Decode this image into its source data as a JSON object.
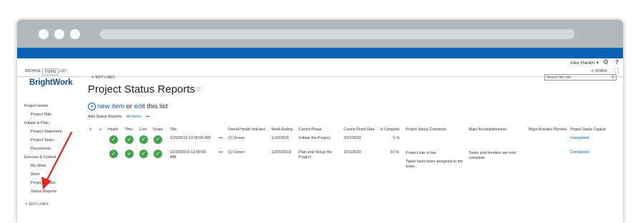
{
  "user": {
    "name": "Alex Hankin"
  },
  "ribbon": {
    "tabs": [
      "BROWSE",
      "ITEMS",
      "LIST"
    ],
    "share_label": "SHARE"
  },
  "logo_text": "BrightWork",
  "edit_links_label": "EDIT LINKS",
  "page_title": "Project Status Reports",
  "search_placeholder": "Search this site",
  "new_item": {
    "new_label": "new item",
    "or_label": "or",
    "edit_label": "edit",
    "tail_label": "this list"
  },
  "views": {
    "add_label": "Add Status Reports",
    "all_items_label": "All Items",
    "more": "•••"
  },
  "nav": {
    "items": [
      {
        "label": "Project Home"
      },
      {
        "label": "Project Wiki"
      },
      {
        "label": "Initiate & Plan"
      },
      {
        "label": "Project Statement"
      },
      {
        "label": "Project Tasks"
      },
      {
        "label": "Documents"
      },
      {
        "label": "Execute & Control"
      },
      {
        "label": "My Work"
      },
      {
        "label": "Work"
      },
      {
        "label": "Project Issues"
      },
      {
        "label": "Status Reports"
      }
    ],
    "edit_label": "EDIT LINKS"
  },
  "table": {
    "columns": [
      "Health",
      "Time",
      "Cost",
      "Scope",
      "Title",
      "Overall Health Indicator",
      "Week Ending",
      "Current Phase",
      "Current Finish Date",
      "% Complete",
      "Project Status Comments",
      "Major Accomplishments",
      "Major Activities Planned",
      "Project Status Capture"
    ],
    "rows": [
      {
        "title": "12/6/2019 12:00:00 AM",
        "overall": "(1) Green",
        "week": "1/10/2020",
        "phase": "Initiate the Project",
        "finish": "3/31/2020",
        "pct": "5 %",
        "comments": "",
        "comments2": "",
        "accomplishments": "",
        "capture": "Completed"
      },
      {
        "title": "12/20/2019 12:00:00 AM",
        "overall": "(1) Green",
        "week": "12/20/2019",
        "phase": "Plan and Setup the Project",
        "finish": "3/31/2020",
        "pct": "10 %",
        "comments": "Project site is live.",
        "comments2": "Tasks have been assigned to the team.",
        "accomplishments": "Tasks and timeline are now complete.",
        "capture": "Completed"
      }
    ]
  },
  "colors": {
    "suite_bar": "#0b62b4",
    "status_green": "#3fa44a",
    "arrow": "#e02424",
    "link": "#0b62b4"
  }
}
